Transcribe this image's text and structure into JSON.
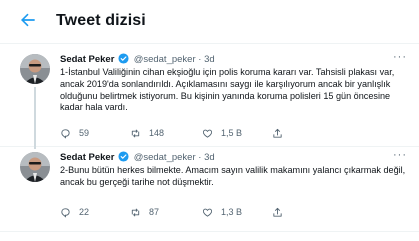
{
  "header": {
    "title": "Tweet dizisi"
  },
  "tweets": [
    {
      "name": "Sedat Peker",
      "handle": "@sedat_peker",
      "dot": "·",
      "time": "3d",
      "more": "···",
      "text": "1-İstanbul Valiliğinin cihan ekşioğlu için polis koruma kararı var. Tahsisli plakası var, ancak 2019'da sonlandırıldı. Açıklamasını saygı ile karşılıyorum ancak bir yanlışlık olduğunu belirtmek istiyorum. Bu kişinin yanında koruma polisleri 15 gün öncesine kadar hala vardı.",
      "replies": "59",
      "retweets": "148",
      "likes": "1,5 B"
    },
    {
      "name": "Sedat Peker",
      "handle": "@sedat_peker",
      "dot": "·",
      "time": "3d",
      "more": "···",
      "text": "2-Bunu bütün herkes bilmekte. Amacım sayın valilik makamını yalancı çıkarmak değil, ancak bu gerçeği tarihe not düşmektir.",
      "replies": "22",
      "retweets": "87",
      "likes": "1,3 B"
    }
  ],
  "icons": {
    "back": "arrow-left-icon",
    "verified": "verified-badge-icon",
    "reply": "reply-icon",
    "retweet": "retweet-icon",
    "like": "heart-icon",
    "share": "share-icon"
  },
  "colors": {
    "accent": "#1d9bf0",
    "text": "#0f1419",
    "secondary": "#536471",
    "divider": "#eff3f4"
  }
}
